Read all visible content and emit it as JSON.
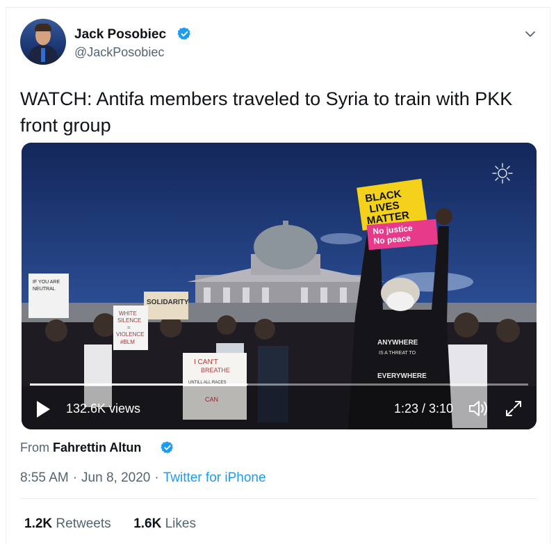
{
  "author": {
    "name": "Jack Posobiec",
    "handle": "@JackPosobiec",
    "verified": true
  },
  "tweet": {
    "text": "WATCH: Antifa members traveled to Syria to train with PKK front group"
  },
  "video": {
    "views": "132.6K views",
    "time": "1:23 / 3:10",
    "progress": 0.437,
    "signs": {
      "blm": [
        "BLACK",
        "LIVES",
        "MATTER"
      ],
      "blm_sub": [
        "No justice",
        "No peace"
      ],
      "solidarity": "SOLIDARITY",
      "white_silence": [
        "WHITE",
        "SILENCE",
        "=",
        "VIOLENCE",
        "#BLM"
      ],
      "i_cant_breathe": [
        "I CAN'T",
        "BREATHE",
        "UNTILL ALL RACES",
        "CAN"
      ],
      "neutral": [
        "IF YOU ARE",
        "NEUTRAL"
      ],
      "shirt": [
        "ANYWHERE",
        "IS A THREAT TO",
        "EVERYWHERE"
      ]
    }
  },
  "source": {
    "prefix": "From",
    "name": "Fahrettin Altun"
  },
  "meta": {
    "time": "8:55 AM",
    "date": "Jun 8, 2020",
    "client": "Twitter for iPhone"
  },
  "stats": {
    "retweets_count": "1.2K",
    "retweets_label": "Retweets",
    "likes_count": "1.6K",
    "likes_label": "Likes"
  },
  "colors": {
    "accent": "#1d9bf0",
    "text": "#0f1419",
    "muted": "#536471"
  }
}
